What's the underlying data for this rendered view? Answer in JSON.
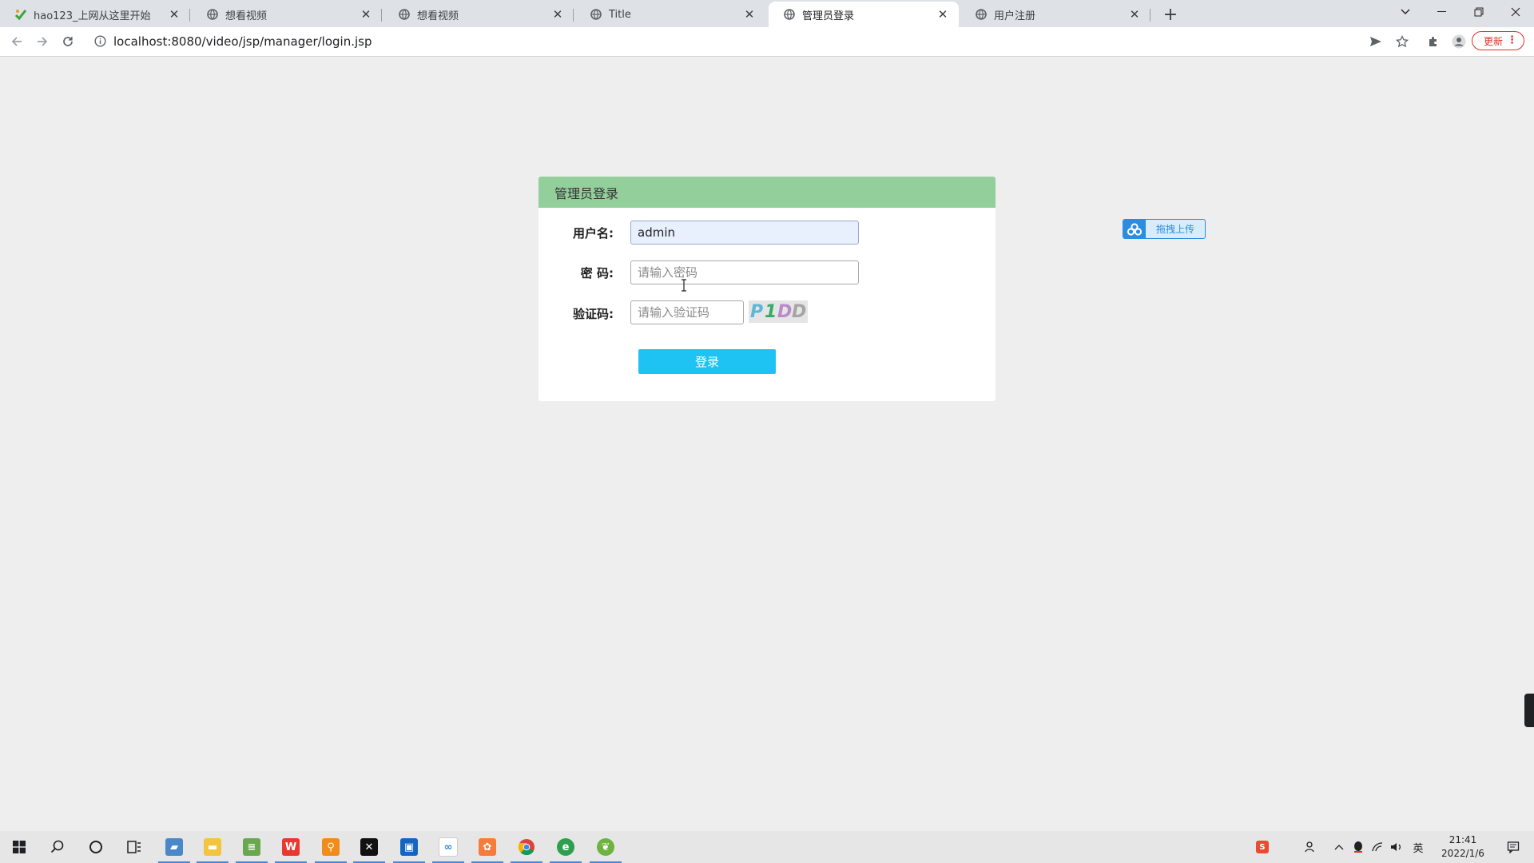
{
  "browser": {
    "tabs": [
      {
        "label": "hao123_上网从这里开始",
        "favicon": "hao123-icon",
        "active": false
      },
      {
        "label": "想看视频",
        "favicon": "globe-icon",
        "active": false
      },
      {
        "label": "想看视频",
        "favicon": "globe-icon",
        "active": false
      },
      {
        "label": "Title",
        "favicon": "globe-icon",
        "active": false
      },
      {
        "label": "管理员登录",
        "favicon": "globe-icon",
        "active": true
      },
      {
        "label": "用户注册",
        "favicon": "globe-icon",
        "active": false
      }
    ],
    "url": "localhost:8080/video/jsp/manager/login.jsp",
    "update_label": "更新"
  },
  "login": {
    "header": "管理员登录",
    "username_label": "用户名:",
    "username_value": "admin",
    "password_label": "密 码:",
    "password_placeholder": "请输入密码",
    "captcha_label": "验证码:",
    "captcha_placeholder": "请输入验证码",
    "captcha_text": [
      "P",
      "1",
      "D",
      "D"
    ],
    "submit_label": "登录"
  },
  "upload_widget": {
    "label": "拖拽上传"
  },
  "taskbar": {
    "apps": [
      "windows-start-icon",
      "search-icon",
      "cortana-icon",
      "task-view-icon",
      "app-icon",
      "file-explorer-icon",
      "notepad-icon",
      "wps-icon",
      "search-app-icon",
      "capcut-icon",
      "meeting-icon",
      "baidu-netdisk-icon",
      "game-icon",
      "chrome-icon",
      "ie-icon",
      "spring-icon"
    ],
    "time": "21:41",
    "date": "2022/1/6"
  },
  "colors": {
    "header_green": "#93cf9b",
    "login_button": "#1fc3f3",
    "upload_blue": "#2b8ce0"
  }
}
